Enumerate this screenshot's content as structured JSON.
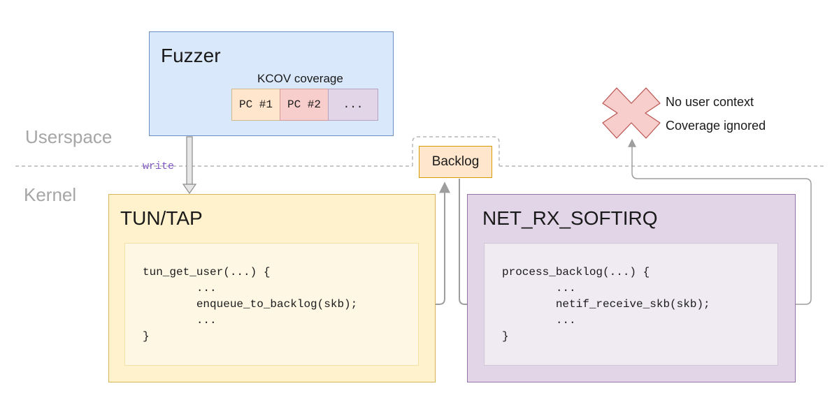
{
  "regions": {
    "userspace": "Userspace",
    "kernel": "Kernel"
  },
  "fuzzer": {
    "title": "Fuzzer",
    "kcov_label": "KCOV coverage",
    "cells": [
      {
        "label": "PC #1",
        "color": "#ffe6cc"
      },
      {
        "label": "PC #2",
        "color": "#f8cecc"
      },
      {
        "label": "...",
        "color": "#e1d5e7"
      }
    ]
  },
  "write_label": "write",
  "tun_tap": {
    "title": "TUN/TAP",
    "code": [
      "tun_get_user(...) {",
      "        ...",
      "        enqueue_to_backlog(skb);",
      "        ...",
      "}"
    ]
  },
  "backlog": {
    "label": "Backlog"
  },
  "net_rx": {
    "title": "NET_RX_SOFTIRQ",
    "code": [
      "process_backlog(...) {",
      "        ...",
      "        netif_receive_skb(skb);",
      "        ...",
      "}"
    ]
  },
  "notes": {
    "line1": "No user context",
    "line2": "Coverage ignored"
  },
  "colors": {
    "fuzzer_fill": "#dae8fc",
    "tun_fill": "#fff2cc",
    "net_fill": "#e1d5e7",
    "backlog_fill": "#ffe6cc",
    "x_mark": "#f8cecc",
    "connector": "#a6a6a6"
  }
}
